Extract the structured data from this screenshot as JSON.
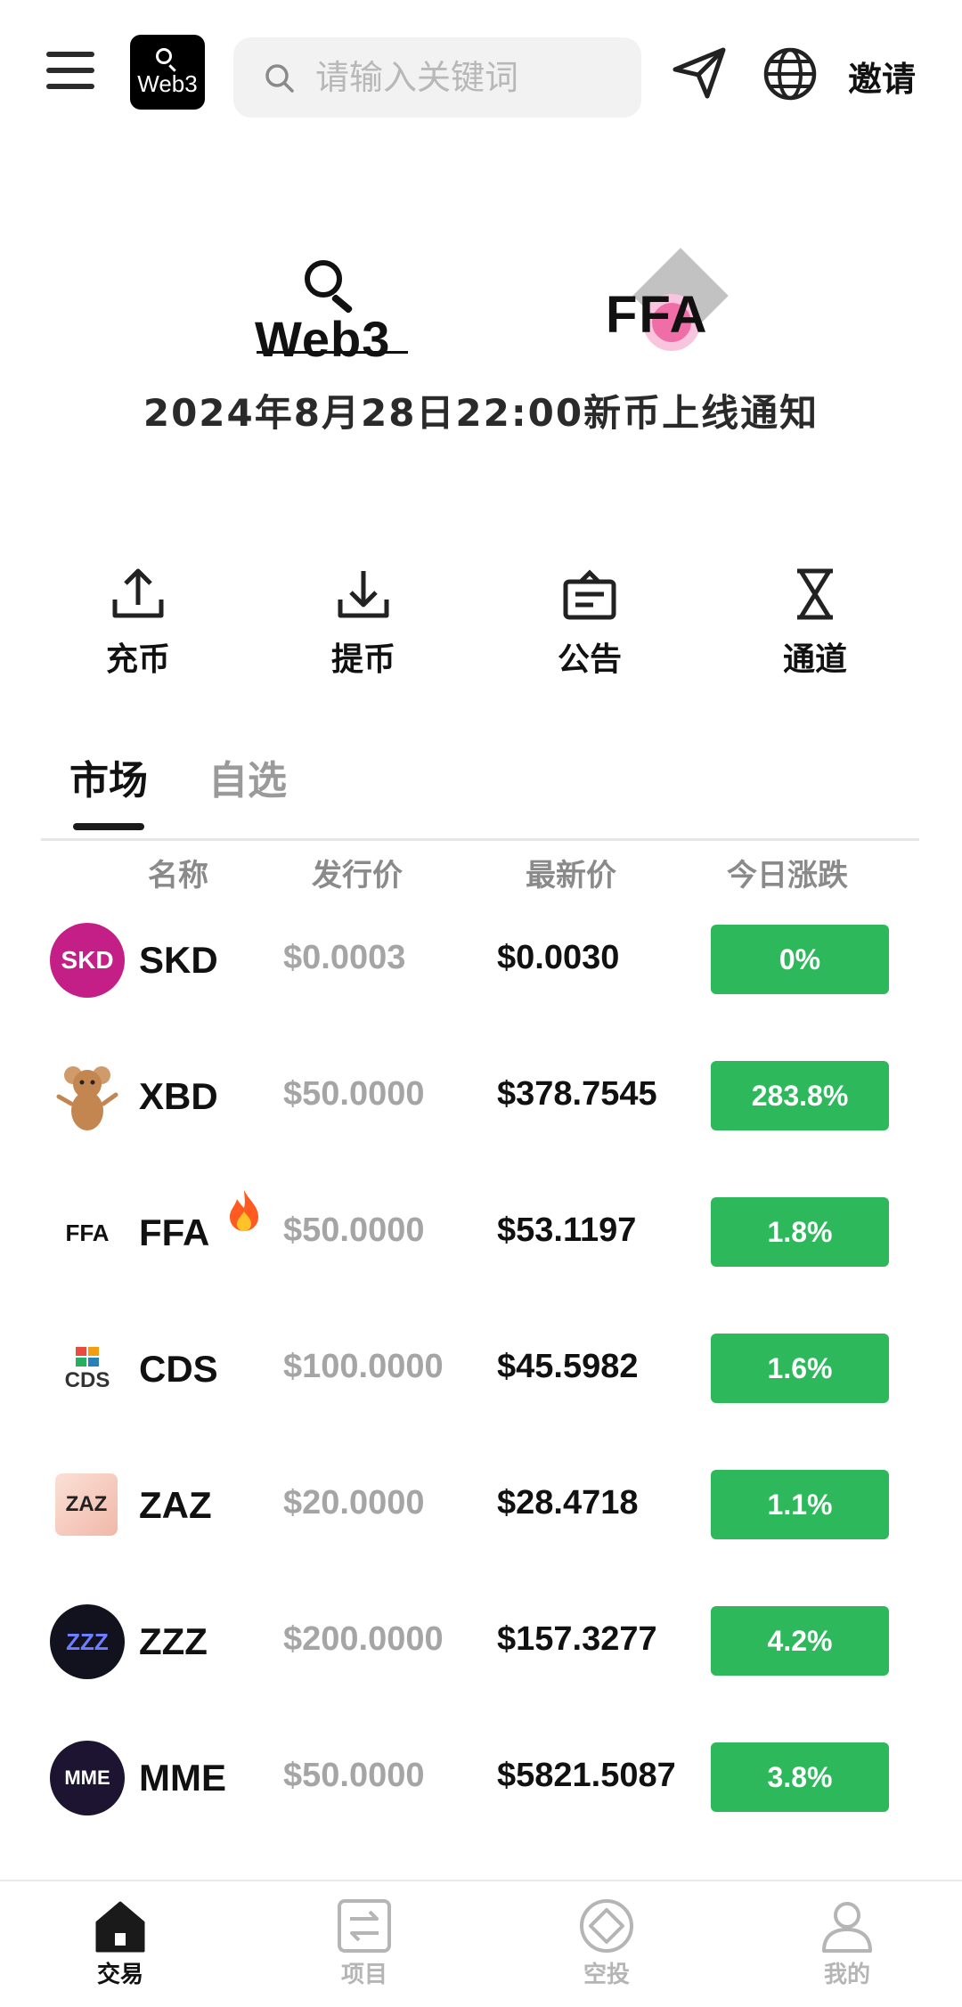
{
  "header": {
    "logo_text": "Web3",
    "search_placeholder": "请输入关键词",
    "invite_label": "邀请"
  },
  "banner": {
    "brand_left": "Web3",
    "brand_right": "FFA",
    "title": "2024年8月28日22:00新币上线通知"
  },
  "actions": [
    {
      "label": "充币",
      "icon": "upload-icon"
    },
    {
      "label": "提币",
      "icon": "download-icon"
    },
    {
      "label": "公告",
      "icon": "announcement-icon"
    },
    {
      "label": "通道",
      "icon": "hourglass-icon"
    }
  ],
  "tabs": [
    {
      "label": "市场",
      "active": true
    },
    {
      "label": "自选",
      "active": false
    }
  ],
  "table": {
    "headers": [
      "名称",
      "发行价",
      "最新价",
      "今日涨跌"
    ],
    "rows": [
      {
        "name": "SKD",
        "logo_text": "SKD",
        "issue_price": "$0.0003",
        "latest_price": "$0.0030",
        "change": "0%"
      },
      {
        "name": "XBD",
        "logo_text": "",
        "issue_price": "$50.0000",
        "latest_price": "$378.7545",
        "change": "283.8%"
      },
      {
        "name": "FFA",
        "logo_text": "FFA",
        "issue_price": "$50.0000",
        "latest_price": "$53.1197",
        "change": "1.8%",
        "hot": true
      },
      {
        "name": "CDS",
        "logo_text": "CDS",
        "issue_price": "$100.0000",
        "latest_price": "$45.5982",
        "change": "1.6%"
      },
      {
        "name": "ZAZ",
        "logo_text": "ZAZ",
        "issue_price": "$20.0000",
        "latest_price": "$28.4718",
        "change": "1.1%"
      },
      {
        "name": "ZZZ",
        "logo_text": "ZZZ",
        "issue_price": "$200.0000",
        "latest_price": "$157.3277",
        "change": "4.2%"
      },
      {
        "name": "MME",
        "logo_text": "MME",
        "issue_price": "$50.0000",
        "latest_price": "$5821.5087",
        "change": "3.8%"
      }
    ]
  },
  "bottom_nav": [
    {
      "label": "交易",
      "active": true,
      "icon": "home-icon"
    },
    {
      "label": "项目",
      "active": false,
      "icon": "exchange-icon"
    },
    {
      "label": "空投",
      "active": false,
      "icon": "airdrop-icon"
    },
    {
      "label": "我的",
      "active": false,
      "icon": "profile-icon"
    }
  ],
  "colors": {
    "positive": "#2db85c",
    "text": "#111111",
    "muted": "#a5a5a5"
  }
}
